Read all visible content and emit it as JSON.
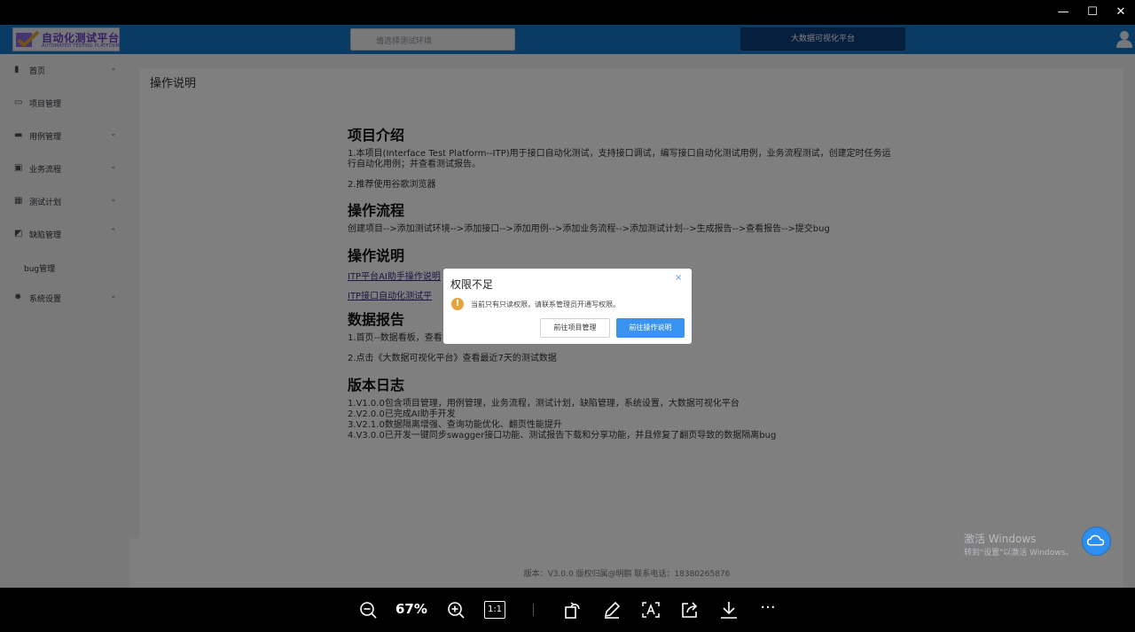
{
  "viewer": {
    "minimize": "—",
    "maximize": "☐",
    "close": "✕",
    "zoom": "67%",
    "tools": [
      "zoom-out",
      "zoom-in",
      "actual-size",
      "rotate",
      "edit",
      "text-recognize",
      "share",
      "download",
      "more"
    ],
    "actual_size_label": "1:1",
    "more_label": "···"
  },
  "header": {
    "logo_text": "自动化测试平台",
    "logo_sub": "AUTOMATED TESTING PLATFORM",
    "env_placeholder": "请选择测试环境",
    "bigdata_label": "大数据可视化平台"
  },
  "sidebar": {
    "items": [
      {
        "label": "首页",
        "icon": "bar-chart-icon",
        "arrow": "⌄"
      },
      {
        "label": "项目管理",
        "icon": "folder-icon",
        "arrow": ""
      },
      {
        "label": "用例管理",
        "icon": "briefcase-icon",
        "arrow": "⌄"
      },
      {
        "label": "业务流程",
        "icon": "suitcase-icon",
        "arrow": "⌄"
      },
      {
        "label": "测试计划",
        "icon": "calendar-icon",
        "arrow": "⌄"
      },
      {
        "label": "缺陷管理",
        "icon": "edit-icon",
        "arrow": "⌃"
      },
      {
        "label": "系统设置",
        "icon": "gear-icon",
        "arrow": "⌄"
      }
    ],
    "sub_item": "bug管理"
  },
  "main": {
    "title": "操作说明",
    "sections": {
      "intro_title": "项目介绍",
      "intro_p1a": "1.本项目(Interface Test Platform--ITP)用于接口自动化测试，支持接口调试，编写接口自动化测试用例，业务流程测试，创建定时任务运",
      "intro_p1b": "行自动化用例；并查看测试报告。",
      "intro_p2": "2.推荐使用谷歌浏览器",
      "flow_title": "操作流程",
      "flow_p": "创建项目-->添加测试环境-->添加接口-->添加用例-->添加业务流程-->添加测试计划-->生成报告-->查看报告-->提交bug",
      "guide_title": "操作说明",
      "guide_link1": "ITP平台AI助手操作说明",
      "guide_link2": "ITP接口自动化测试平",
      "report_title": "数据报告",
      "report_p1": "1.首页--数据看板，查看",
      "report_p2": "2.点击《大数据可视化平台》查看最近7天的测试数据",
      "log_title": "版本日志",
      "log_1": "1.V1.0.0包含项目管理，用例管理，业务流程，测试计划，缺陷管理，系统设置，大数据可视化平台",
      "log_2": "2.V2.0.0已完成AI助手开发",
      "log_3": "3.V2.1.0数据隔离增强、查询功能优化、翻页性能提升",
      "log_4": "4.V3.0.0已开发一键同步swagger接口功能、测试报告下载和分享功能，并且修复了翻页导致的数据隔离bug"
    }
  },
  "footer": {
    "text": "版本：V3.0.0 版权归属@明鹏 联系电话：18380265876"
  },
  "dialog": {
    "title": "权限不足",
    "close": "×",
    "warn": "!",
    "message": "当前只有只读权限，请联系管理员开通写权限。",
    "btn_secondary": "前往项目管理",
    "btn_primary": "前往操作说明"
  },
  "activation": {
    "line1": "激活 Windows",
    "line2": "转到\"设置\"以激活 Windows。"
  },
  "colors": {
    "topbar": "#1476c8",
    "primary_btn": "#3a93f0",
    "warn": "#e6a23c",
    "bigdata": "#0e3f7c"
  }
}
